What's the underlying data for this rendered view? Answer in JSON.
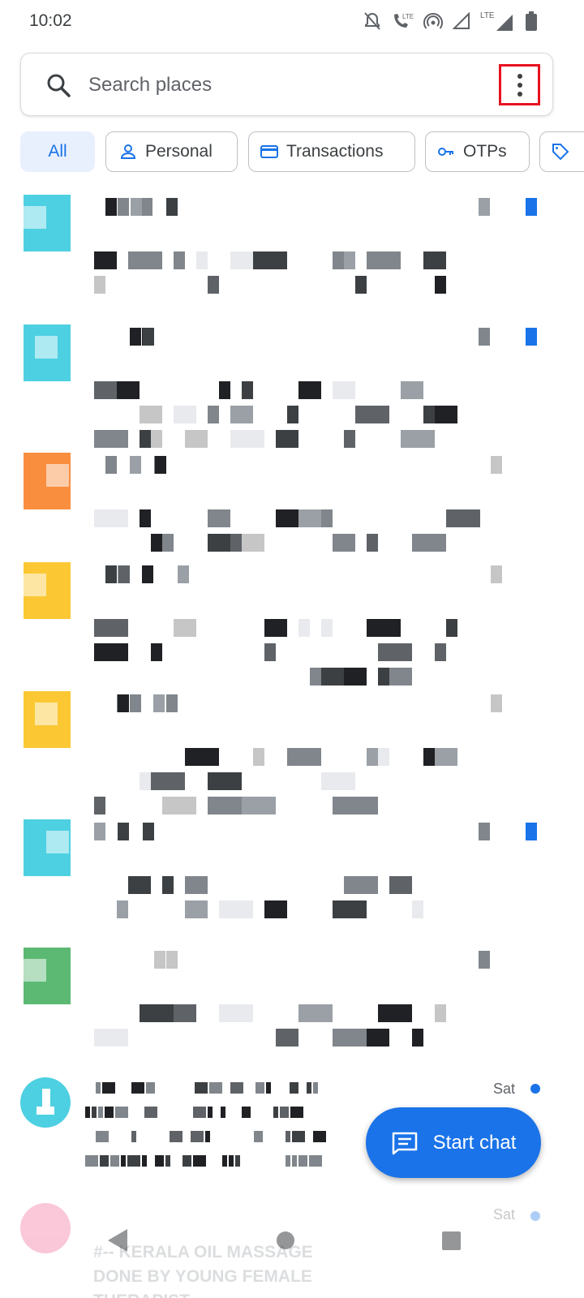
{
  "status_bar": {
    "time": "10:02",
    "icons": [
      "mute-icon",
      "volte-call-icon",
      "hotspot-icon",
      "signal-icon",
      "lte-signal-icon",
      "battery-icon"
    ],
    "lte_label": "LTE"
  },
  "search": {
    "placeholder": "Search places"
  },
  "chips": [
    {
      "label": "All",
      "icon": null,
      "active": true
    },
    {
      "label": "Personal",
      "icon": "person-icon",
      "active": false
    },
    {
      "label": "Transactions",
      "icon": "credit-card-icon",
      "active": false
    },
    {
      "label": "OTPs",
      "icon": "key-icon",
      "active": false
    },
    {
      "label": "",
      "icon": "tag-icon",
      "active": false
    }
  ],
  "conversations": {
    "visible_row": {
      "time": "Sat",
      "unread": true
    },
    "faded_row": {
      "time": "Sat",
      "preview": "#-- KERALA OIL MASSAGE DONE BY YOUNG FEMALE THERAPIST"
    }
  },
  "fab": {
    "label": "Start chat",
    "icon": "chat-icon"
  },
  "colors": {
    "accent": "#1a73e8",
    "highlight_box": "#e8121f",
    "avatar_cyan": "#4dd0e1",
    "avatar_orange": "#f98e3f",
    "avatar_yellow": "#fbc834",
    "avatar_green": "#5bb974",
    "avatar_pink": "#f06292"
  }
}
